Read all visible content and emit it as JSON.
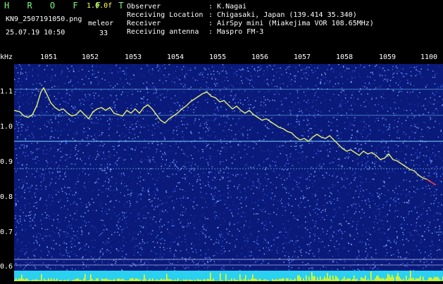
{
  "header": {
    "app_name": "H R O F F T",
    "version": "1.0.0f",
    "filename": "KN9_2507191050.png",
    "datetime": "25.07.19 10:50",
    "mode_label": "meleor",
    "count": "33",
    "fields": [
      {
        "label": "Observer",
        "value": ": K.Nagai"
      },
      {
        "label": "Receiving Location",
        "value": ": Chigasaki, Japan (139.414 35.340)"
      },
      {
        "label": "Receiver",
        "value": ": AirSpy mini (Miakejima VOR 108.65MHz)"
      },
      {
        "label": "Receiving antenna",
        "value": ": Maspro FM-3"
      }
    ]
  },
  "axes": {
    "y_unit": "kHz",
    "x_ticks": [
      "1051",
      "1052",
      "1053",
      "1054",
      "1055",
      "1056",
      "1057",
      "1058",
      "1059",
      "1100"
    ],
    "y_ticks": [
      "1.1",
      "1.0",
      "0.9",
      "0.8",
      "0.7",
      "0.6"
    ]
  },
  "colors": {
    "background": "#0a1a7a",
    "noise_bright": "#6ea0ff",
    "trace": "#e8f070",
    "trace_end": "#ff4040",
    "hline": "#7fd8ff",
    "bottom_strip": "#2ad0f0",
    "bottom_peaks": "#ffff00"
  }
}
